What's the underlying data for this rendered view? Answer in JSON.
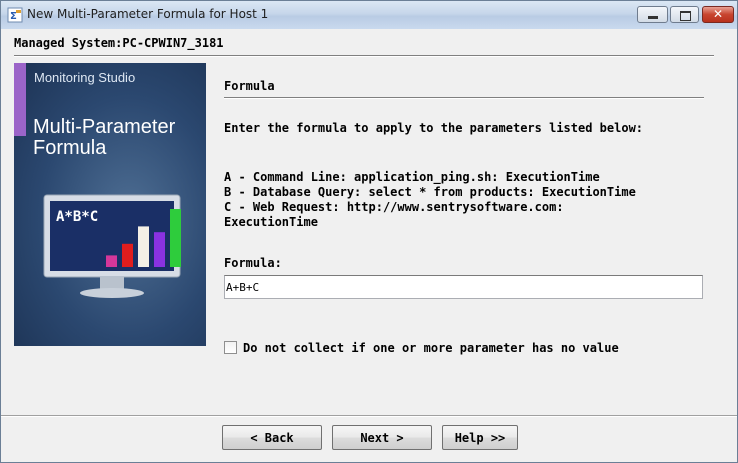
{
  "window": {
    "title": "New Multi-Parameter Formula for Host 1",
    "minimize_icon": "minimize-icon",
    "maximize_icon": "maximize-icon",
    "close_icon": "close-icon",
    "close_glyph": "✕"
  },
  "header": {
    "managed_system": "Managed System:PC-CPWIN7_3181"
  },
  "side_image": {
    "brand": "Monitoring Studio",
    "product_line1": "Multi-Parameter",
    "product_line2": "Formula",
    "monitor_text": "A*B*C",
    "bar_colors": [
      "#d4379a",
      "#e11d1d",
      "#f4f0e6",
      "#8a32e0",
      "#2ecc3c"
    ],
    "bar_values": [
      0.2,
      0.4,
      0.7,
      0.6,
      1.0
    ]
  },
  "section": {
    "title": "Formula",
    "instructions": "Enter the formula to apply to the parameters listed below:",
    "parameters": [
      "A - Command Line: application_ping.sh: ExecutionTime",
      "B - Database Query: select * from products: ExecutionTime",
      "C - Web Request: http://www.sentrysoftware.com:\nExecutionTime"
    ],
    "formula_label": "Formula:",
    "formula_value": "A+B+C",
    "checkbox_label": "Do not collect if one or more parameter has no value",
    "checkbox_checked": false
  },
  "buttons": {
    "back": "< Back",
    "next": "Next >",
    "help": "Help >>"
  },
  "colors": {
    "accent": "#9b64c8",
    "image_bg": "#2b4870"
  }
}
